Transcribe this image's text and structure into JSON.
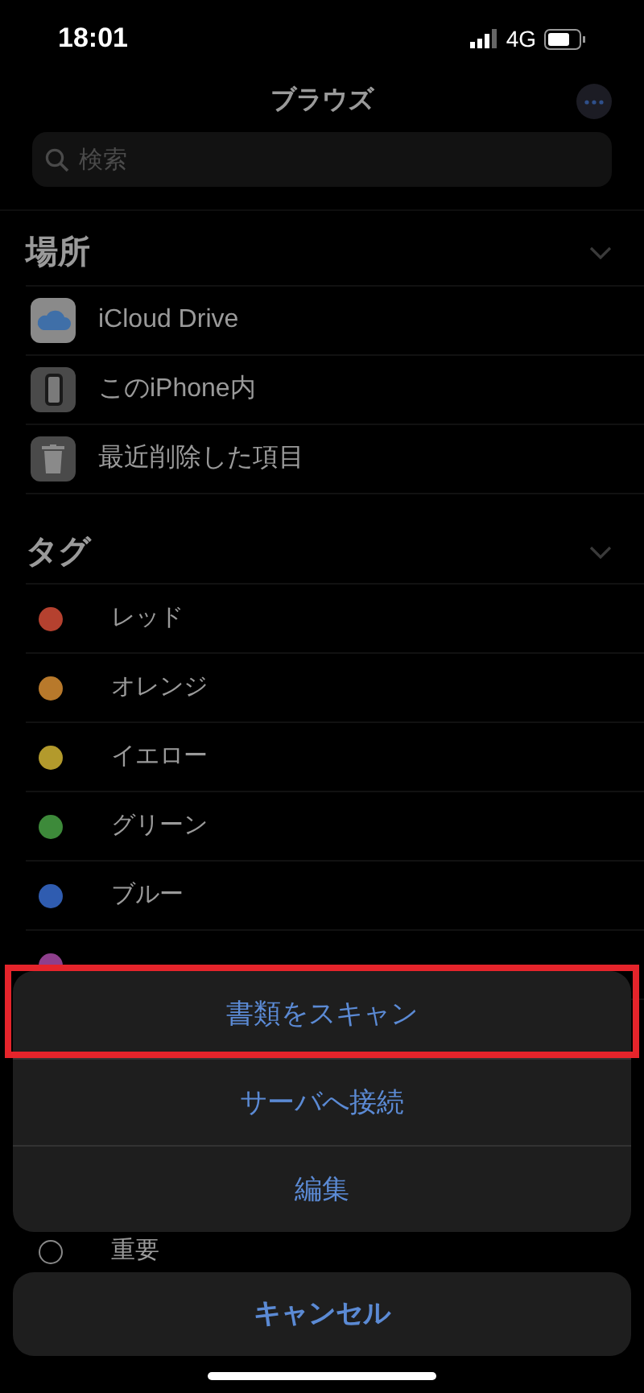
{
  "status_bar": {
    "time": "18:01",
    "network": "4G"
  },
  "nav": {
    "title": "ブラウズ"
  },
  "search": {
    "placeholder": "検索"
  },
  "locations": {
    "title": "場所",
    "items": [
      {
        "label": "iCloud Drive",
        "kind": "cloud"
      },
      {
        "label": "このiPhone内",
        "kind": "phone"
      },
      {
        "label": "最近削除した項目",
        "kind": "trash"
      }
    ]
  },
  "tags": {
    "title": "タグ",
    "items": [
      {
        "label": "レッド",
        "color": "#b5412f"
      },
      {
        "label": "オレンジ",
        "color": "#b8792b"
      },
      {
        "label": "イエロー",
        "color": "#b39a2c"
      },
      {
        "label": "グリーン",
        "color": "#3d8a3a"
      },
      {
        "label": "ブルー",
        "color": "#2f5cb0"
      },
      {
        "color": "#8e3f8c"
      },
      {
        "label": "重要"
      }
    ]
  },
  "action_sheet": {
    "actions": [
      {
        "label": "書類をスキャン",
        "highlighted": true
      },
      {
        "label": "サーバへ接続",
        "highlighted": false
      },
      {
        "label": "編集",
        "highlighted": false
      }
    ],
    "cancel": "キャンセル"
  }
}
